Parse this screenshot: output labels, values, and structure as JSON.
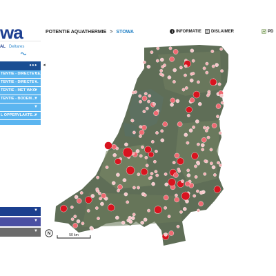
{
  "header": {
    "logo_text": "wa",
    "sublogo_left": "AL",
    "sublogo_right": "Deltares",
    "breadcrumb_root": "POTENTIE AQUATHERMIE",
    "breadcrumb_sep": ">",
    "breadcrumb_current": "STOWA",
    "info_label": "INFORMATIE",
    "disclaimer_label": "DISLAIMER",
    "corner_label": "PD"
  },
  "sidebar": {
    "menu_dots": "•••",
    "collapse_glyph": "◂",
    "layers": [
      {
        "label": "TENTIE - DIRECTE LE..."
      },
      {
        "label": "TENTIE - DIRECTE ..."
      },
      {
        "label": "TENTIE - MET WKO"
      },
      {
        "label": "TENTIE - BODEM..."
      },
      {
        "label": "L OPPERVLAKTE..."
      }
    ],
    "bottom_panels": [
      {
        "color": "#1b3f8f"
      },
      {
        "color": "#4a4fa3"
      },
      {
        "color": "#6b6b6b"
      }
    ]
  },
  "map": {
    "north_label": "N",
    "scale_label": "50 km"
  },
  "colors": {
    "brand": "#1d3f91",
    "accent": "#1f7fc4",
    "layer": "#5bb5f0",
    "point_light": "#f4b1b3",
    "point_mid": "#ef6a72",
    "point_dark": "#d8141f"
  }
}
